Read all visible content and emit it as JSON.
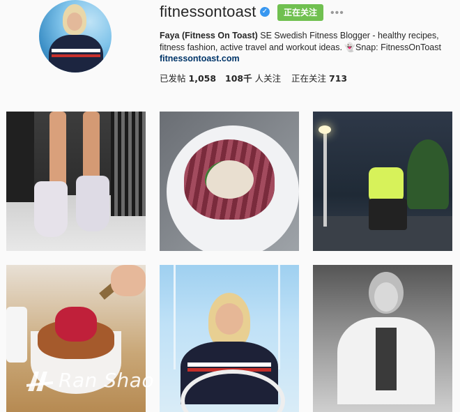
{
  "profile": {
    "username": "fitnessontoast",
    "follow_label": "正在关注",
    "more_label": "•••",
    "bio_name": "Faya (Fitness On Toast)",
    "bio_text": " SE Swedish Fitness Blogger - healthy recipes, fitness fashion, active travel and workout ideas. 👻Snap: FitnessOnToast",
    "bio_link": "fitnessontoast.com",
    "stats": {
      "posts_label": "已发帖",
      "posts_value": "1,058",
      "followers_value": "108千",
      "followers_label": "人关注",
      "following_label": "正在关注",
      "following_value": "713"
    }
  },
  "grid": {
    "posts": [
      {
        "subject": "sneakers-jump"
      },
      {
        "subject": "scallop-dish"
      },
      {
        "subject": "night-squat"
      },
      {
        "subject": "berry-crumble"
      },
      {
        "subject": "sailing-portrait"
      },
      {
        "subject": "bw-portrait"
      }
    ]
  },
  "watermark": {
    "text": "Ran Shao"
  },
  "colors": {
    "follow_button": "#70c050",
    "verified_badge": "#3897f0",
    "link": "#003569",
    "background": "#fafafa"
  },
  "icons": [
    "verified-badge-icon",
    "more-options-icon"
  ]
}
